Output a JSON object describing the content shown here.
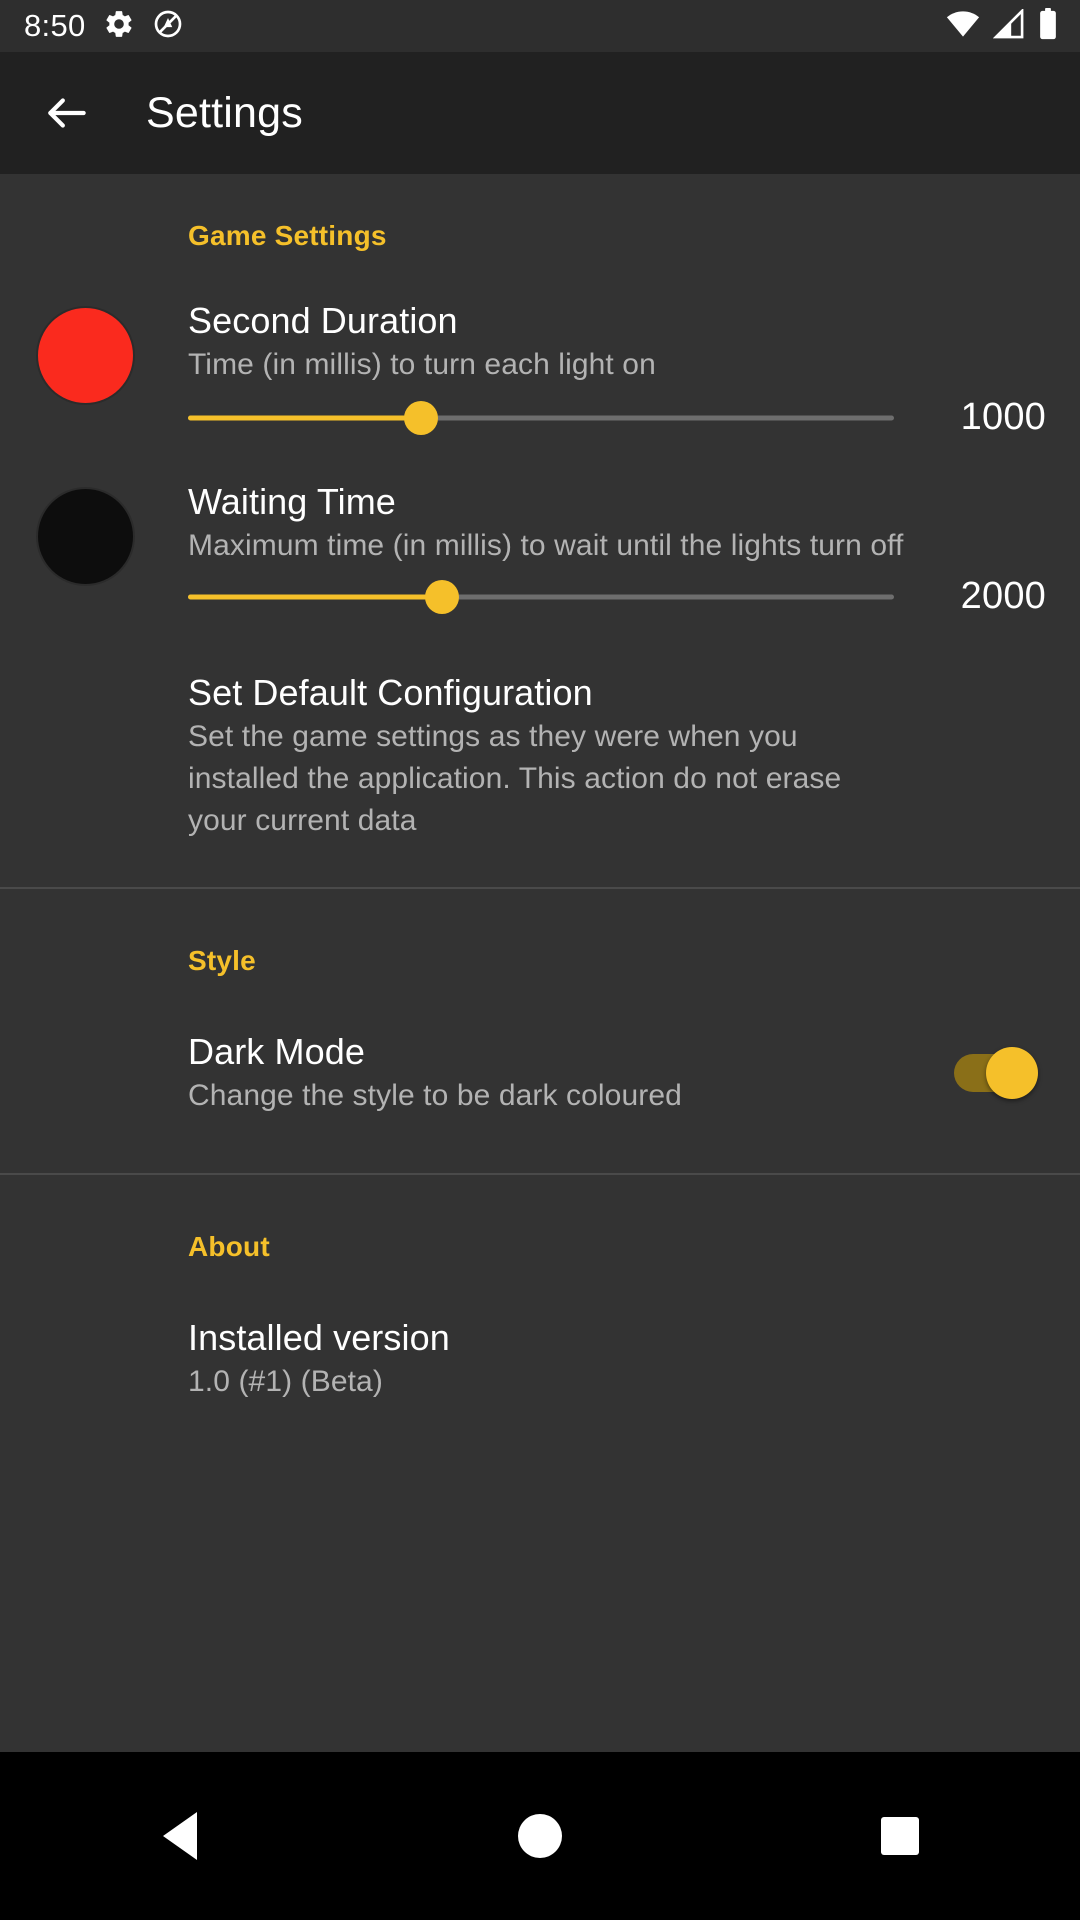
{
  "status_bar": {
    "time": "8:50",
    "icons_left": [
      "gear-icon",
      "do-not-disturb-icon"
    ],
    "icons_right": [
      "wifi-icon",
      "cellular-signal-icon",
      "battery-icon"
    ]
  },
  "app_bar": {
    "back_icon": "back-arrow-icon",
    "title": "Settings"
  },
  "sections": {
    "game": {
      "header": "Game Settings",
      "second_duration": {
        "title": "Second Duration",
        "summary": "Time (in millis) to turn each light on",
        "value": "1000",
        "slider_percent": 33,
        "icon": "red-light-icon"
      },
      "waiting_time": {
        "title": "Waiting Time",
        "summary": "Maximum time (in millis) to wait until the lights turn off",
        "value": "2000",
        "slider_percent": 36,
        "icon": "off-light-icon"
      },
      "set_default": {
        "title": "Set Default Configuration",
        "summary": "Set the game settings as they were when you installed the application. This action do not erase your current data"
      }
    },
    "style": {
      "header": "Style",
      "dark_mode": {
        "title": "Dark Mode",
        "summary": "Change the style to be dark coloured",
        "enabled": "on"
      }
    },
    "about": {
      "header": "About",
      "installed_version": {
        "title": "Installed version",
        "summary": "1.0 (#1) (Beta)"
      }
    }
  },
  "nav_bar": {
    "back": "back-triangle-icon",
    "home": "home-circle-icon",
    "recents": "recents-square-icon"
  },
  "colors": {
    "accent": "#f5c02a",
    "background": "#333333",
    "app_bar": "#212121",
    "status_bar": "#2e2e2e",
    "light_red": "#fa2a1e"
  }
}
